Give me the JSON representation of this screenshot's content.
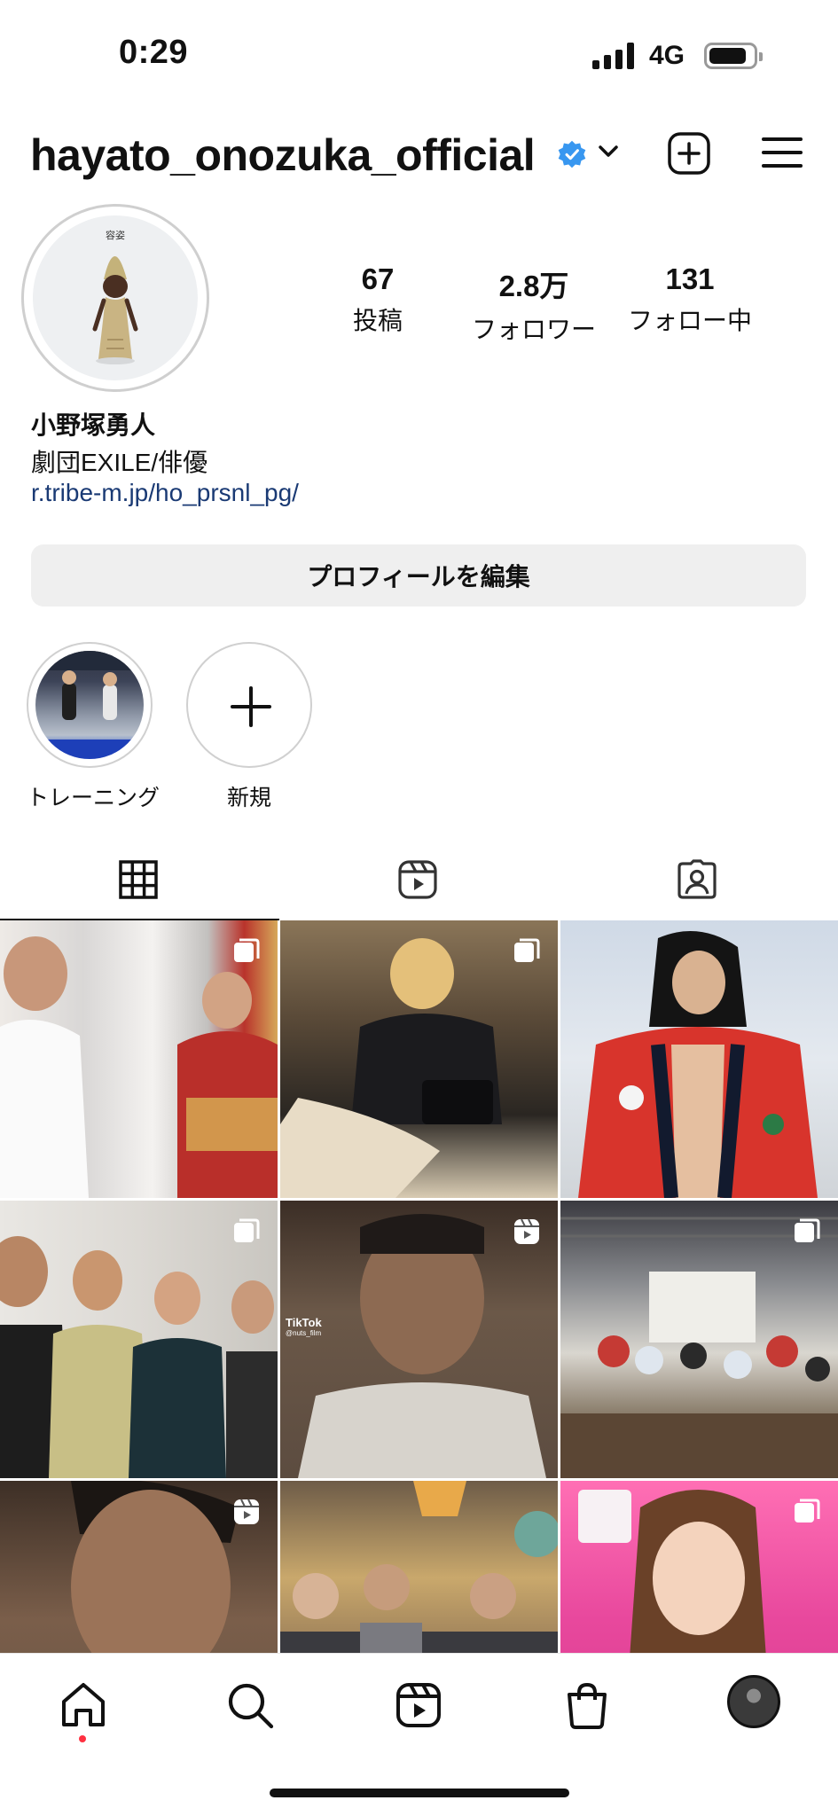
{
  "status_bar": {
    "time": "0:29",
    "network": "4G",
    "battery_level": 0.85
  },
  "header": {
    "username": "hayato_onozuka_official"
  },
  "profile": {
    "avatar_tag": "容姿",
    "stats": [
      {
        "value": "67",
        "label": "投稿"
      },
      {
        "value": "2.8万",
        "label": "フォロワー"
      },
      {
        "value": "131",
        "label": "フォロー中"
      }
    ],
    "name": "小野塚勇人",
    "bio": "劇団EXILE/俳優",
    "link": "r.tribe-m.jp/ho_prsnl_pg/",
    "edit_button": "プロフィールを編集"
  },
  "highlights": [
    {
      "label": "トレーニング"
    },
    {
      "label": "新規"
    }
  ],
  "tabs": [
    "grid-icon",
    "reels-icon",
    "tagged-icon"
  ],
  "posts": [
    {
      "type": "carousel"
    },
    {
      "type": "carousel"
    },
    {
      "type": "photo"
    },
    {
      "type": "carousel"
    },
    {
      "type": "reel",
      "overlay_brand": "TikTok",
      "overlay_handle": "@nuts_film"
    },
    {
      "type": "carousel"
    },
    {
      "type": "reel"
    },
    {
      "type": "photo"
    },
    {
      "type": "carousel"
    }
  ],
  "bottom_nav": [
    "home-icon",
    "search-icon",
    "reels-icon",
    "shop-icon",
    "profile-avatar"
  ],
  "colors": {
    "link": "#1a3a74",
    "verified": "#3897f0",
    "notification_dot": "#ff3040"
  }
}
